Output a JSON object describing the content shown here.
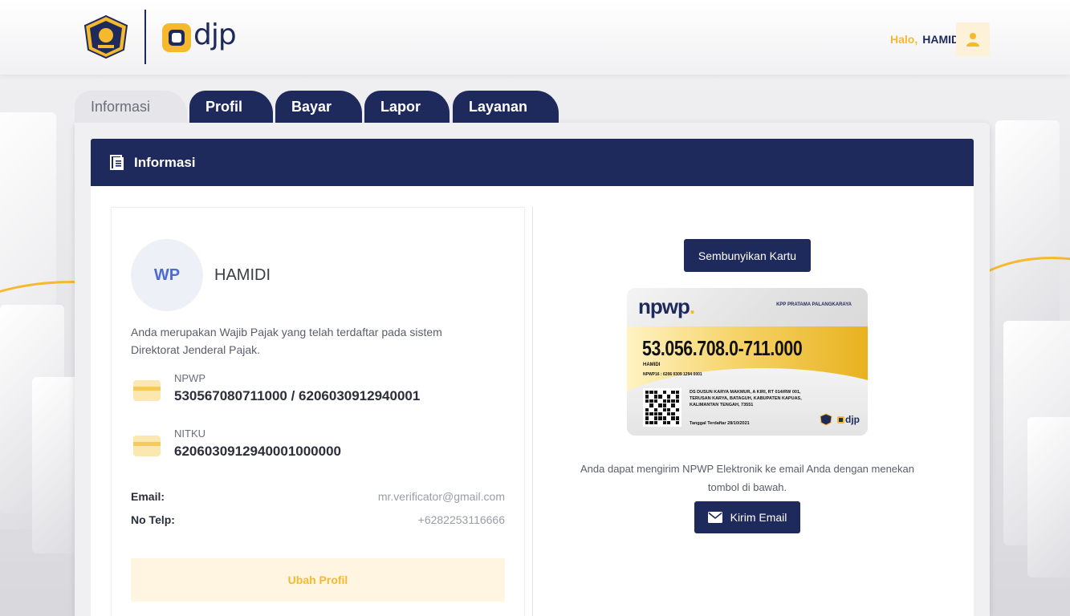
{
  "header": {
    "greeting": "Halo,",
    "user_name": "HAMIDI",
    "logo_text": "djp"
  },
  "tabs": [
    {
      "label": "Informasi",
      "active": true
    },
    {
      "label": "Profil",
      "active": false
    },
    {
      "label": "Bayar",
      "active": false
    },
    {
      "label": "Lapor",
      "active": false
    },
    {
      "label": "Layanan",
      "active": false
    }
  ],
  "section": {
    "title": "Informasi"
  },
  "profile": {
    "initials": "WP",
    "name": "HAMIDI",
    "description": "Anda merupakan Wajib Pajak yang telah terdaftar pada sistem Direktorat Jenderal Pajak.",
    "npwp_label": "NPWP",
    "npwp_value": "530567080711000 / 6206030912940001",
    "nitku_label": "NITKU",
    "nitku_value": "6206030912940001000000",
    "email_label": "Email:",
    "email_value": "mr.verificator@gmail.com",
    "phone_label": "No Telp:",
    "phone_value": "+6282253116666",
    "edit_button": "Ubah Profil"
  },
  "card_panel": {
    "hide_button": "Sembunyikan Kartu",
    "email_note": "Anda dapat mengirim NPWP Elektronik ke email Anda dengan menekan tombol di bawah.",
    "send_button": "Kirim Email"
  },
  "npwp_card": {
    "brand_pre": "npwp",
    "brand_dot": ".",
    "kpp": "KPP PRATAMA PALANGKARAYA",
    "number": "53.056.708.0-711.000",
    "holder": "HAMIDI",
    "npwp16": "NPWP16 : 6206 0309 1294 0001",
    "address": "DS DUSUN KARYA MAKMUR, A KIRI, RT 014/RW 001, TERUSAN KARYA, BATAGUH, KABUPATEN KAPUAS, KALIMANTAN TENGAH, 73551",
    "registered": "Tanggal Terdaftar 28/10/2021",
    "mini_logo": "djp"
  },
  "colors": {
    "navy": "#1f2a5c",
    "gold": "#f5b92e",
    "accent_blue": "#4a6bd6"
  }
}
